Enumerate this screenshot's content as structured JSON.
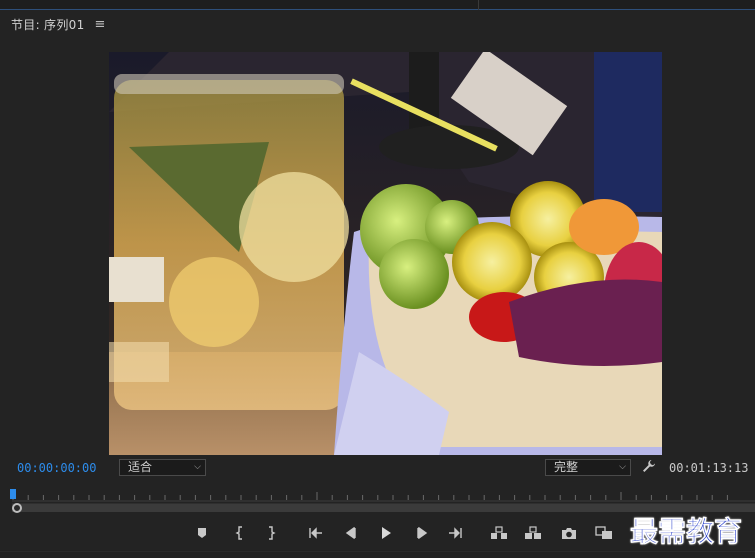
{
  "panel": {
    "title": "节目: 序列01",
    "menu_icon": "hamburger-menu-icon"
  },
  "monitor": {
    "current_timecode": "00:00:00:00",
    "zoom_select": "适合",
    "resolution_select": "完整",
    "settings_icon": "wrench-icon",
    "duration_timecode": "00:01:13:13",
    "playhead_position": 0.0
  },
  "transport": {
    "buttons": [
      {
        "name": "add-marker-button",
        "icon": "marker-icon"
      },
      {
        "name": "mark-in-button",
        "icon": "mark-in-icon"
      },
      {
        "name": "mark-out-button",
        "icon": "mark-out-icon"
      },
      {
        "name": "go-to-in-button",
        "icon": "go-to-in-icon"
      },
      {
        "name": "step-back-button",
        "icon": "step-back-icon"
      },
      {
        "name": "play-button",
        "icon": "play-icon"
      },
      {
        "name": "step-forward-button",
        "icon": "step-forward-icon"
      },
      {
        "name": "go-to-out-button",
        "icon": "go-to-out-icon"
      },
      {
        "name": "lift-button",
        "icon": "lift-icon"
      },
      {
        "name": "extract-button",
        "icon": "extract-icon"
      },
      {
        "name": "export-frame-button",
        "icon": "camera-icon"
      },
      {
        "name": "compare-view-button",
        "icon": "compare-icon"
      }
    ]
  },
  "watermark": {
    "text": "最需教育"
  },
  "colors": {
    "accent": "#2d8ceb",
    "panel_bg": "#232323",
    "watermark": "#1c34c8"
  }
}
